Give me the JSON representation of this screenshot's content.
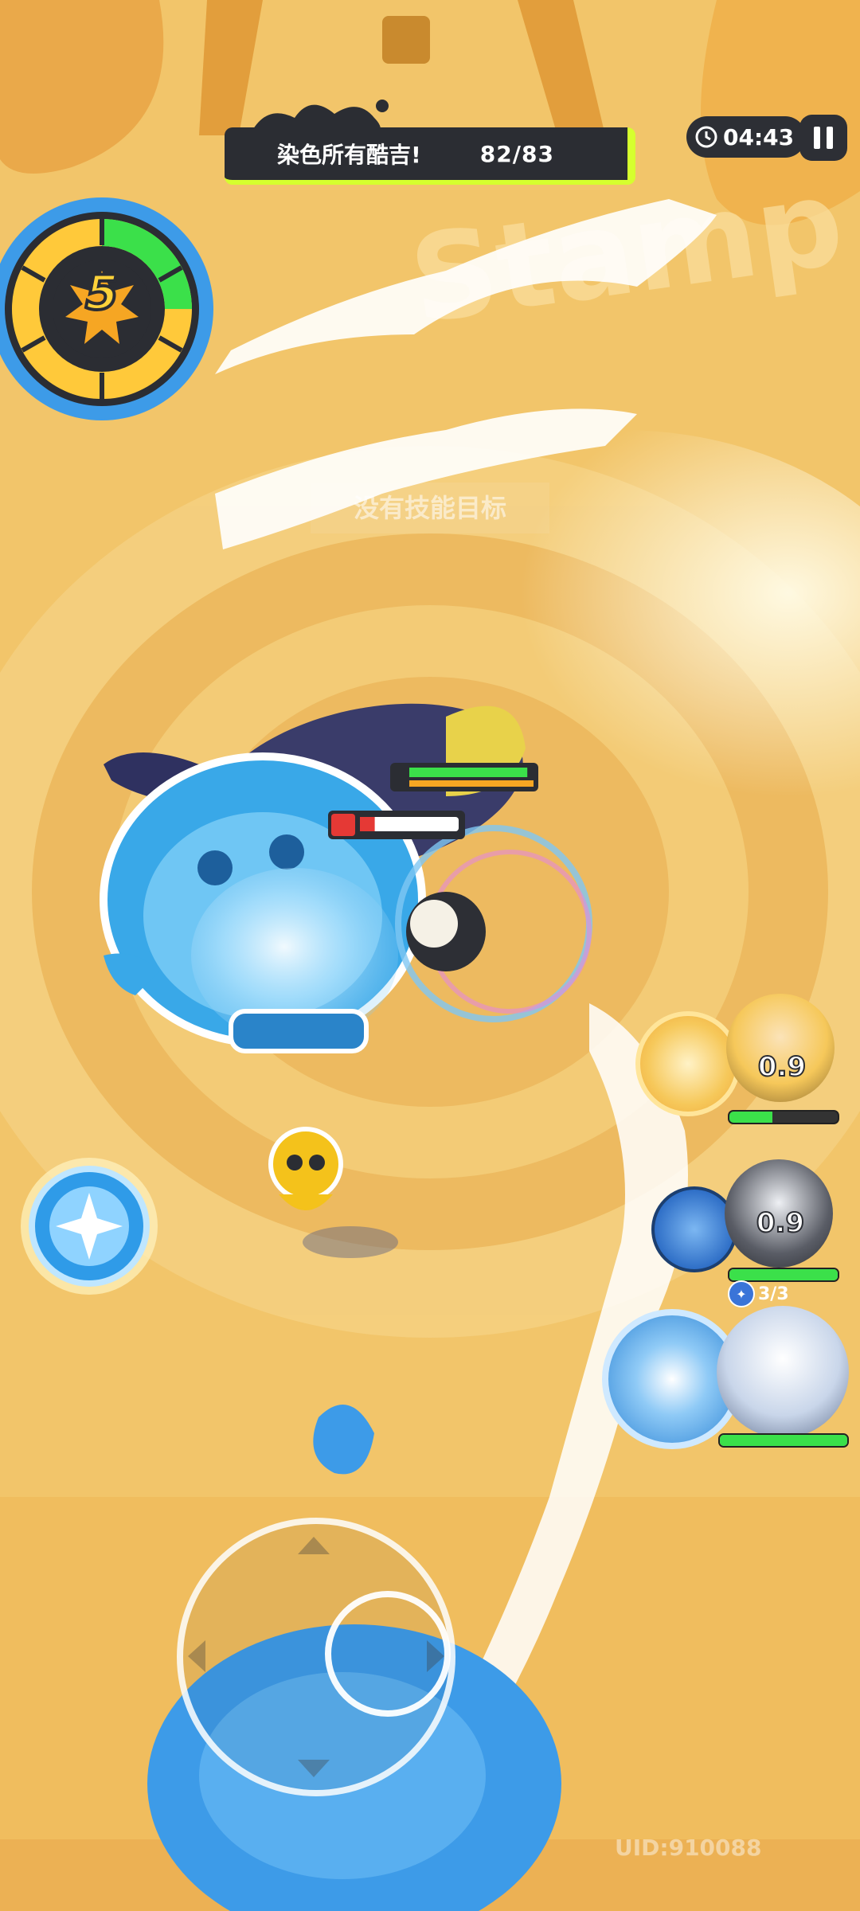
{
  "objective": {
    "label": "染色所有酷吉!",
    "progress": "82/83",
    "current": 82,
    "total": 83
  },
  "timer": {
    "text": "04:43"
  },
  "level": {
    "value": "5",
    "ring_progress": 0.25
  },
  "hint": {
    "text": "没有技能目标"
  },
  "boss_hp": {
    "fraction": 0.95
  },
  "enemy_hp": {
    "fraction": 0.15
  },
  "party": [
    {
      "cooldown": "0.9",
      "hp_fraction": 0.4,
      "color": "#f6c85a"
    },
    {
      "cooldown": "0.9",
      "hp_fraction": 1.0,
      "color": "#5a5d66"
    },
    {
      "cooldown": "",
      "hp_fraction": 1.0,
      "color": "#c9d6ea",
      "charges": "3/3"
    }
  ],
  "uid": "UID:910088",
  "colors": {
    "ink_blue": "#3d9be8",
    "accent_green": "#d6ff2e",
    "panel_dark": "#2b2d33",
    "ground": "#f2c56a",
    "hp_green": "#3be04a",
    "hp_red": "#e53935"
  }
}
